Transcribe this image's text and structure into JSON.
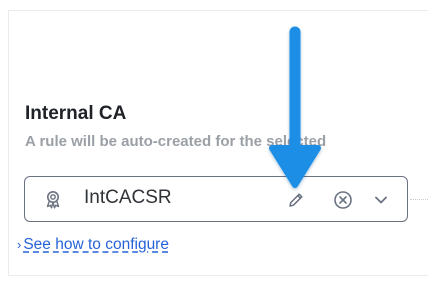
{
  "section": {
    "title": "Internal CA",
    "description": "A rule will be auto-created for the selected"
  },
  "select": {
    "value": "IntCACSR",
    "leading_icon": "certificate-badge-icon",
    "actions": [
      "pencil-edit-icon",
      "clear-circle-x-icon",
      "chevron-down-icon"
    ]
  },
  "help_link": {
    "caret": "›",
    "label": "See how to configure"
  },
  "annotation": {
    "type": "arrow-down",
    "color": "#1d8ee6"
  },
  "colors": {
    "title": "#1f2328",
    "description": "#9aa0a6",
    "link": "#2563d9",
    "border": "#6b7280",
    "annotation": "#1d8ee6"
  }
}
